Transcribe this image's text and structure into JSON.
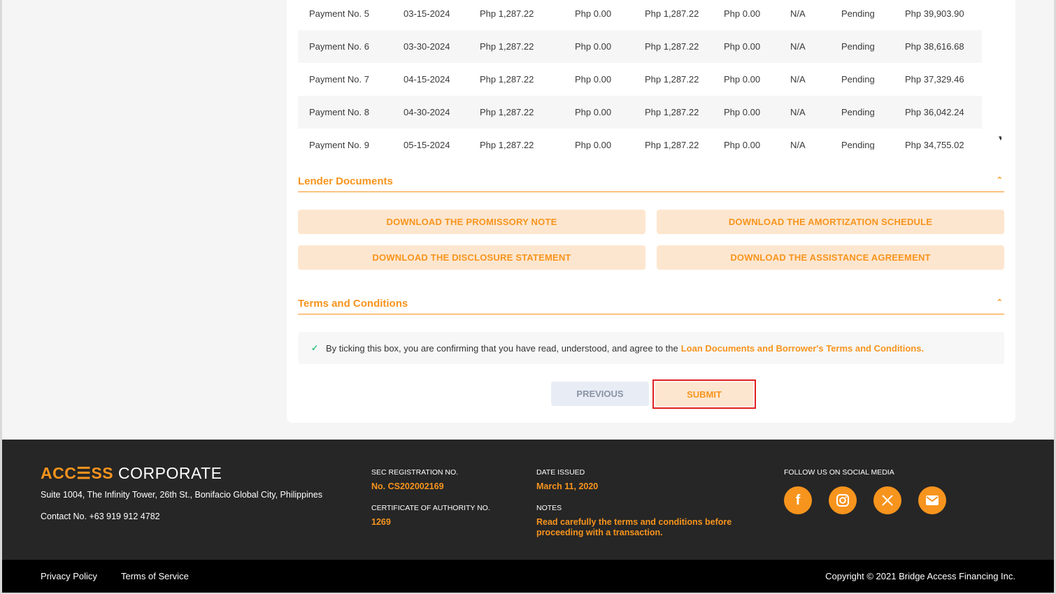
{
  "schedule": {
    "rows": [
      {
        "label": "Payment No. 5",
        "date": "03-15-2024",
        "amount": "Php 1,287.22",
        "penalty": "Php 0.00",
        "total": "Php 1,287.22",
        "paid": "Php 0.00",
        "ref": "N/A",
        "status": "Pending",
        "balance": "Php 39,903.90"
      },
      {
        "label": "Payment No. 6",
        "date": "03-30-2024",
        "amount": "Php 1,287.22",
        "penalty": "Php 0.00",
        "total": "Php 1,287.22",
        "paid": "Php 0.00",
        "ref": "N/A",
        "status": "Pending",
        "balance": "Php 38,616.68"
      },
      {
        "label": "Payment No. 7",
        "date": "04-15-2024",
        "amount": "Php 1,287.22",
        "penalty": "Php 0.00",
        "total": "Php 1,287.22",
        "paid": "Php 0.00",
        "ref": "N/A",
        "status": "Pending",
        "balance": "Php 37,329.46"
      },
      {
        "label": "Payment No. 8",
        "date": "04-30-2024",
        "amount": "Php 1,287.22",
        "penalty": "Php 0.00",
        "total": "Php 1,287.22",
        "paid": "Php 0.00",
        "ref": "N/A",
        "status": "Pending",
        "balance": "Php 36,042.24"
      },
      {
        "label": "Payment No. 9",
        "date": "05-15-2024",
        "amount": "Php 1,287.22",
        "penalty": "Php 0.00",
        "total": "Php 1,287.22",
        "paid": "Php 0.00",
        "ref": "N/A",
        "status": "Pending",
        "balance": "Php 34,755.02"
      }
    ]
  },
  "lender_documents": {
    "title": "Lender Documents",
    "buttons": [
      "DOWNLOAD THE PROMISSORY NOTE",
      "DOWNLOAD THE AMORTIZATION SCHEDULE",
      "DOWNLOAD THE DISCLOSURE STATEMENT",
      "DOWNLOAD THE ASSISTANCE AGREEMENT"
    ]
  },
  "terms": {
    "title": "Terms and Conditions",
    "checked": true,
    "text": "By ticking this box, you are confirming that you have read, understood, and agree to the",
    "link": "Loan Documents and Borrower's Terms and Conditions."
  },
  "actions": {
    "previous": "PREVIOUS",
    "submit": "SUBMIT"
  },
  "footer": {
    "brand_access": "ACC☰SS",
    "brand_corporate": "CORPORATE",
    "address": "Suite 1004, The Infinity Tower, 26th St., Bonifacio Global City, Philippines",
    "contact": "Contact No. +63 919 912 4782",
    "sec_label": "SEC REGISTRATION NO.",
    "sec_value": "No. CS202002169",
    "coa_label": "CERTIFICATE OF AUTHORITY NO.",
    "coa_value": "1269",
    "date_label": "DATE ISSUED",
    "date_value": "March 11, 2020",
    "notes_label": "NOTES",
    "notes_value": "Read carefully the terms and conditions before proceeding with a transaction.",
    "social_label": "FOLLOW US ON SOCIAL MEDIA",
    "social_icons": [
      "facebook-icon",
      "instagram-icon",
      "x-icon",
      "email-icon"
    ]
  },
  "bottom": {
    "privacy": "Privacy Policy",
    "terms": "Terms of Service",
    "copyright": "Copyright © 2021 Bridge Access Financing Inc."
  },
  "colors": {
    "accent": "#f7941d",
    "accent_light": "#fde6cf",
    "highlight": "#e02020",
    "footer_bg": "#262626"
  }
}
